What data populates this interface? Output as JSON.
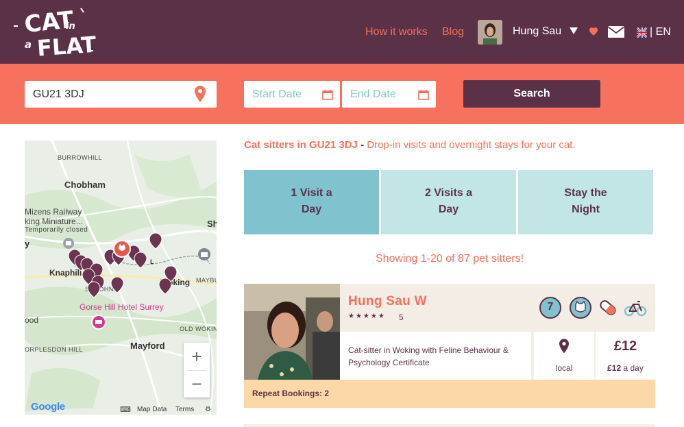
{
  "header": {
    "logo_text": "CAT in a FLAT",
    "nav": [
      {
        "label": "How it works"
      },
      {
        "label": "Blog"
      }
    ],
    "user_name": "Hung Sau",
    "lang": "| EN"
  },
  "search": {
    "location": "GU21 3DJ",
    "start_placeholder": "Start Date",
    "end_placeholder": "End Date",
    "button": "Search"
  },
  "map": {
    "labels": [
      "BURROWHILL",
      "Chobham",
      "Mizens Railway",
      "king Miniature...",
      "Temporarily closed",
      "Knaphill",
      "ST JOHNS",
      "Gorse Hill Hotel Surrey",
      "Woking",
      "MAYBU",
      "ood",
      "OLD WOKIN",
      "Mayford",
      "ORPLESDON HILL",
      "Sh",
      "y",
      "L"
    ],
    "zoom_in": "+",
    "zoom_out": "−",
    "google": "Google",
    "keyboard": "⌨",
    "map_data": "Map Data",
    "terms": "Terms",
    "settings": "⚙"
  },
  "results": {
    "title_place": "Cat sitters in GU21 3DJ",
    "title_dash": " - ",
    "title_desc": "Drop-in visits and overnight stays for your cat.",
    "tabs": [
      {
        "line1": "1 Visit a",
        "line2": "Day"
      },
      {
        "line1": "2 Visits a",
        "line2": "Day"
      },
      {
        "line1": "Stay the",
        "line2": "Night"
      }
    ],
    "showing": "Showing 1-20 of 87 pet sitters!"
  },
  "sitter": {
    "name": "Hung Sau W",
    "stars": "★★★★★",
    "rating": "5",
    "badge_count": "7",
    "description": "Cat-sitter in Woking with Feline Behaviour & Psychology Certificate",
    "location_label": "local",
    "price": "£12",
    "price_unit": "£12",
    "price_unit_suffix": " a day",
    "repeat": "Repeat Bookings: 2"
  },
  "colors": {
    "brand_purple": "#5b3147",
    "brand_coral": "#f8715e",
    "teal_active": "#80c3cf",
    "teal_light": "#c2e6e5"
  }
}
